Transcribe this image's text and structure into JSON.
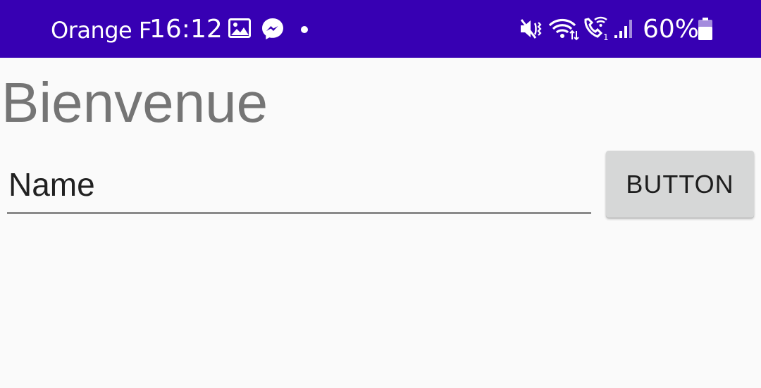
{
  "status_bar": {
    "carrier": "Orange F",
    "time": "16:12",
    "battery": "60%",
    "background": "#3700b3",
    "icons": [
      "gallery-icon",
      "messenger-icon",
      "notification-dot-icon",
      "mute-vibrate-icon",
      "wifi-icon",
      "wifi-calling-icon",
      "signal-icon",
      "battery-icon"
    ]
  },
  "main": {
    "title": "Bienvenue",
    "name_field": {
      "placeholder": "Name",
      "value": ""
    },
    "button_label": "BUTTON"
  },
  "colors": {
    "title": "#757575",
    "button_bg": "#d6d7d7",
    "background": "#fafafa"
  }
}
